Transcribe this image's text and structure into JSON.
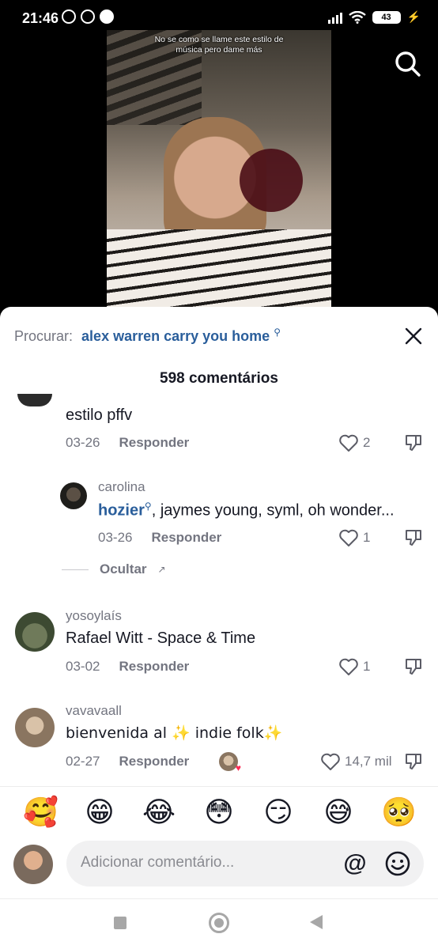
{
  "status_bar": {
    "time": "21:46",
    "battery": "43"
  },
  "video": {
    "caption": "No se como se llame este estilo de música pero dame más"
  },
  "sheet": {
    "search_label": "Procurar:",
    "search_query": "alex warren carry you home",
    "title": "598 comentários"
  },
  "comments": [
    {
      "text": "estilo pffv",
      "date": "03-26",
      "reply": "Responder",
      "likes": "2"
    },
    {
      "user": "carolina",
      "tag": "hozier",
      "text": ", jaymes young, syml, oh wonder...",
      "date": "03-26",
      "reply": "Responder",
      "likes": "1"
    },
    {
      "user": "yosoylaís",
      "text": "Rafael Witt - Space & Time",
      "date": "03-02",
      "reply": "Responder",
      "likes": "1"
    },
    {
      "user": "vavavaall",
      "text": "bienvenida al ✨ indie folk✨",
      "date": "02-27",
      "reply": "Responder",
      "likes": "14,7 mil"
    }
  ],
  "hide_replies": "Ocultar",
  "emojis": [
    "🥰",
    "😁",
    "😂",
    "😳",
    "😏",
    "😅",
    "🥺"
  ],
  "composer": {
    "placeholder": "Adicionar comentário...",
    "at": "@"
  },
  "colors": {
    "accent_link": "#2a5e9b",
    "muted": "#737580"
  },
  "icons": [
    "search-icon",
    "close-icon",
    "heart-icon",
    "dislike-icon",
    "smile-icon"
  ]
}
